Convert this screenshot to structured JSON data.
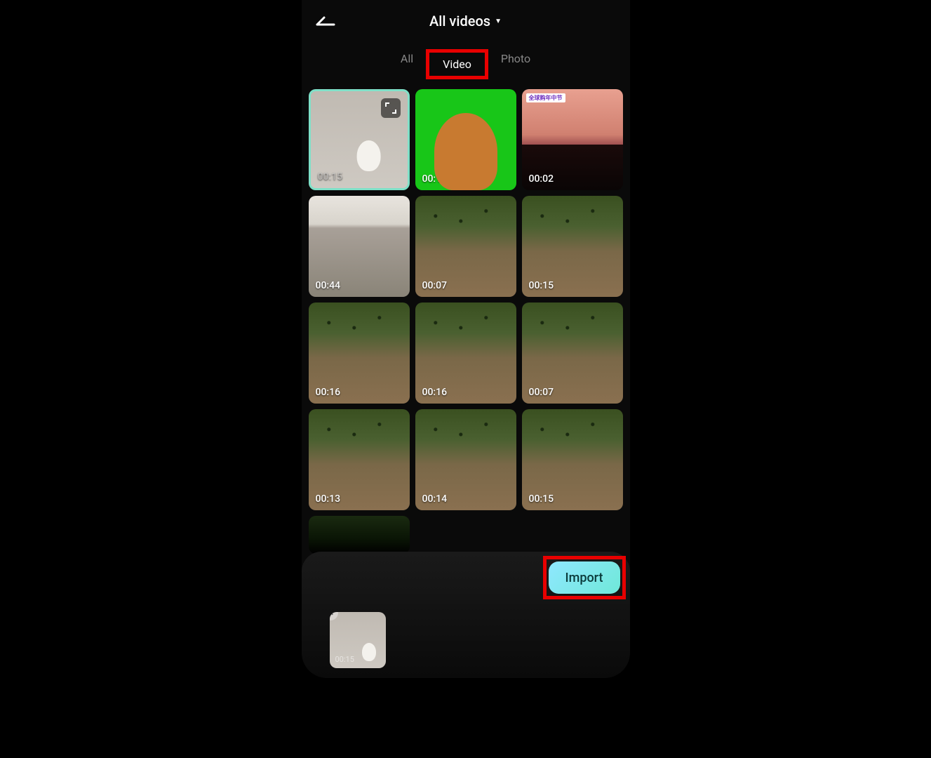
{
  "header": {
    "title": "All videos"
  },
  "tabs": {
    "all": "All",
    "video": "Video",
    "photo": "Photo",
    "active": "video"
  },
  "grid": [
    {
      "duration": "00:15",
      "selected": true,
      "style": "fog",
      "dim_duration": true
    },
    {
      "duration": "00:13",
      "selected": false,
      "style": "cat",
      "dim_duration": false
    },
    {
      "duration": "00:02",
      "selected": false,
      "style": "sunset",
      "dim_duration": false,
      "tag": "全球购年中节"
    },
    {
      "duration": "00:44",
      "selected": false,
      "style": "forestgray",
      "dim_duration": false
    },
    {
      "duration": "00:07",
      "selected": false,
      "style": "forest",
      "dim_duration": false
    },
    {
      "duration": "00:15",
      "selected": false,
      "style": "forest",
      "dim_duration": false
    },
    {
      "duration": "00:16",
      "selected": false,
      "style": "forest",
      "dim_duration": false
    },
    {
      "duration": "00:16",
      "selected": false,
      "style": "forest",
      "dim_duration": false
    },
    {
      "duration": "00:07",
      "selected": false,
      "style": "forest",
      "dim_duration": false
    },
    {
      "duration": "00:13",
      "selected": false,
      "style": "forest",
      "dim_duration": false
    },
    {
      "duration": "00:14",
      "selected": false,
      "style": "forest",
      "dim_duration": false
    },
    {
      "duration": "00:15",
      "selected": false,
      "style": "forest",
      "dim_duration": false
    },
    {
      "duration": "",
      "selected": false,
      "style": "dark",
      "dim_duration": false,
      "partial": true
    }
  ],
  "import_button": "Import",
  "selected_tray": {
    "duration": "00:15"
  },
  "highlights": {
    "tab_video": true,
    "import": true
  }
}
